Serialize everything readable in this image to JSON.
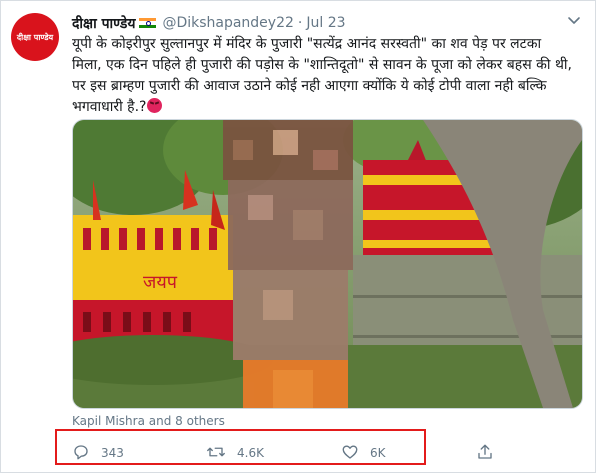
{
  "tweet": {
    "avatar_text": "दीक्षा पाण्डेय",
    "author_name": "दीक्षा पाण्डेय",
    "handle": "@Dikshapandey22",
    "separator": "·",
    "date": "Jul 23",
    "text": "यूपी के कोइरीपुर सुल्तानपुर में मंदिर के पुजारी \"सत्येंद्र आनंद सरस्वती\" का शव पेड़ पर लटका मिला, एक दिन पहिले ही पुजारी की पड़ोस के \"शान्तिदूतो\" से सावन के पूजा को लेकर बहस की थी, पर इस ब्राम्हण पुजारी की आवाज उठाने कोई नही आएगा क्योंकि ये कोई टोपी वाला नही बल्कि भगवाधारी है.?",
    "photo_sign_text": "जयप",
    "liked_by": "Kapil Mishra and 8 others",
    "reply_count": "343",
    "retweet_count": "4.6K",
    "like_count": "6K"
  },
  "colors": {
    "avatar_bg": "#d9131c",
    "secondary_text": "#657786",
    "highlight_box": "#e31b1b",
    "wall_red": "#c6162a",
    "wall_yellow": "#f2c51b"
  },
  "icons": [
    "caret-down-icon",
    "india-flag-icon",
    "angry-face-icon",
    "reply-icon",
    "retweet-icon",
    "like-icon",
    "share-icon"
  ]
}
